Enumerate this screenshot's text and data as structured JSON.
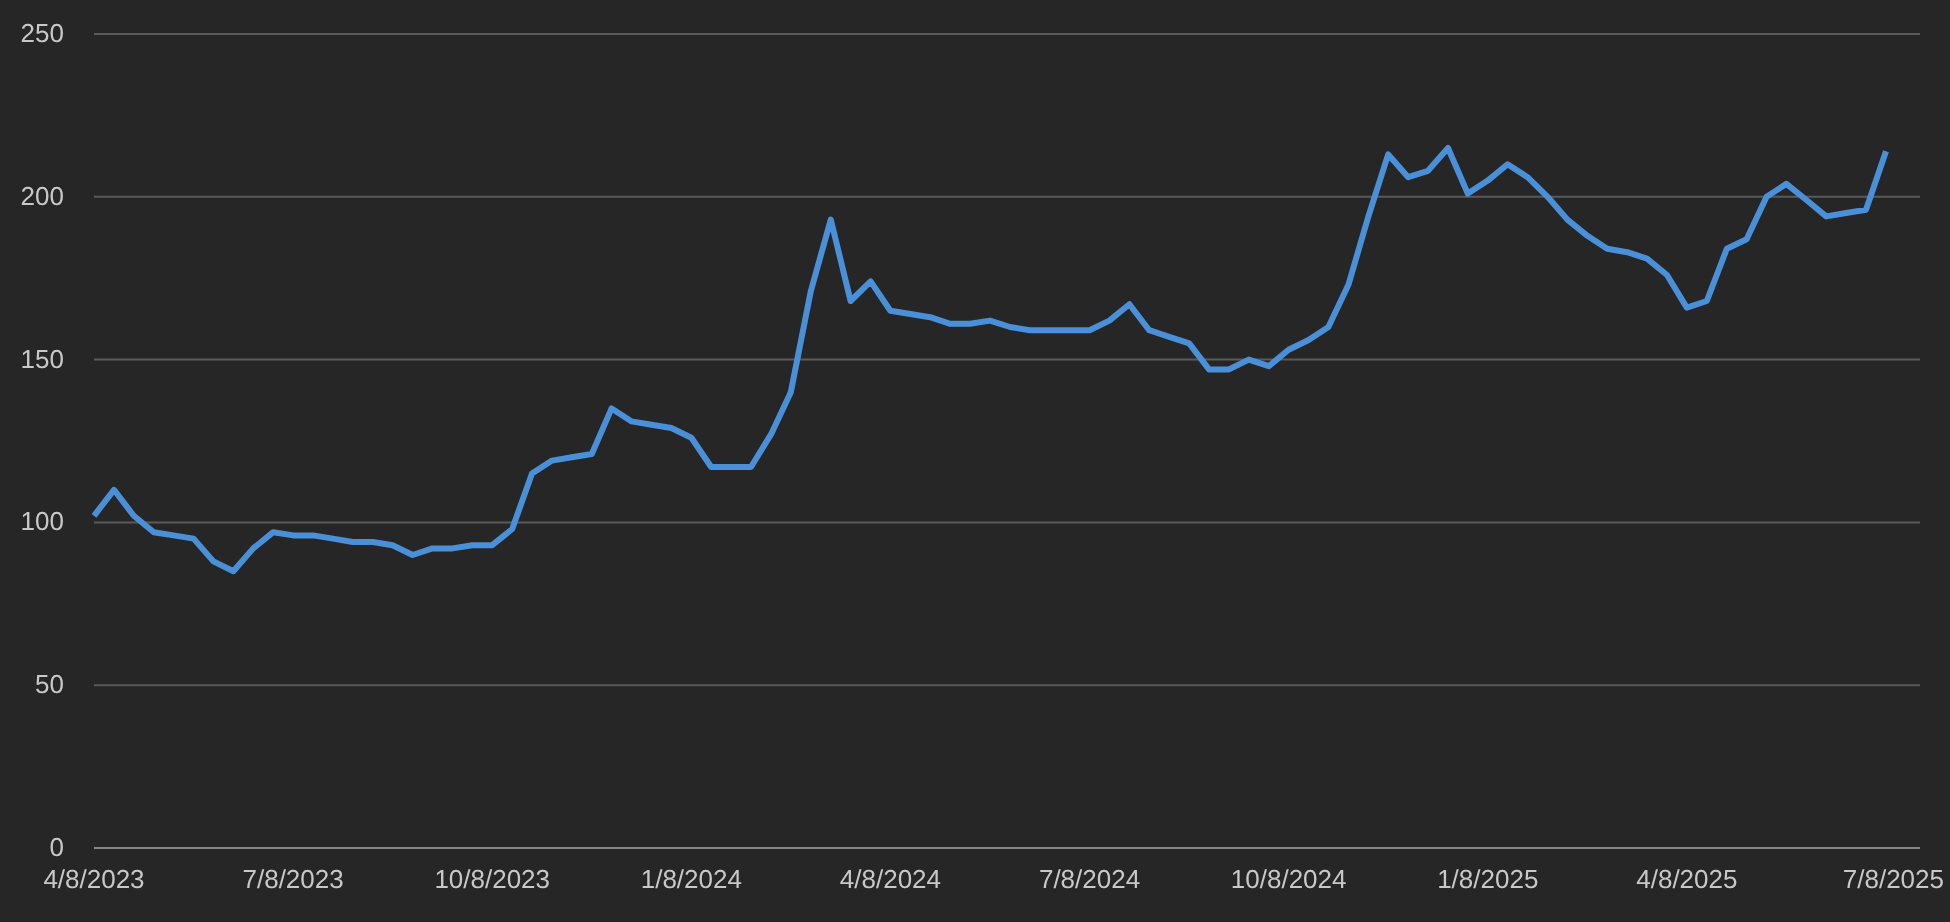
{
  "chart_data": {
    "type": "line",
    "grid": true,
    "ylim": [
      0,
      250
    ],
    "yticks": [
      0,
      50,
      100,
      150,
      200,
      250
    ],
    "categories": [
      "4/8/2023",
      null,
      null,
      null,
      null,
      null,
      null,
      null,
      null,
      null,
      "7/8/2023",
      null,
      null,
      null,
      null,
      null,
      null,
      null,
      null,
      null,
      "10/8/2023",
      null,
      null,
      null,
      null,
      null,
      null,
      null,
      null,
      null,
      "1/8/2024",
      null,
      null,
      null,
      null,
      null,
      null,
      null,
      null,
      null,
      "4/8/2024",
      null,
      null,
      null,
      null,
      null,
      null,
      null,
      null,
      null,
      "7/8/2024",
      null,
      null,
      null,
      null,
      null,
      null,
      null,
      null,
      null,
      "10/8/2024",
      null,
      null,
      null,
      null,
      null,
      null,
      null,
      null,
      null,
      "1/8/2025",
      null,
      null,
      null,
      null,
      null,
      null,
      null,
      null,
      null,
      "4/8/2025",
      null,
      null,
      null,
      null,
      null,
      null,
      null,
      null,
      null,
      "7/8/2025"
    ],
    "series": [
      {
        "color": "#4a90d9",
        "values": [
          102,
          110,
          102,
          97,
          96,
          95,
          88,
          85,
          92,
          97,
          96,
          96,
          95,
          94,
          94,
          93,
          90,
          92,
          92,
          93,
          93,
          98,
          115,
          119,
          120,
          121,
          135,
          131,
          130,
          129,
          126,
          117,
          117,
          117,
          127,
          140,
          171,
          193,
          168,
          174,
          165,
          164,
          163,
          161,
          161,
          162,
          160,
          159,
          159,
          159,
          159,
          162,
          167,
          159,
          157,
          155,
          147,
          147,
          150,
          148,
          153,
          156,
          160,
          173,
          194,
          213,
          206,
          208,
          215,
          201,
          205,
          210,
          206,
          200,
          193,
          188,
          184,
          183,
          181,
          176,
          166,
          168,
          184,
          187,
          200,
          204,
          199,
          194,
          195,
          196,
          214
        ]
      }
    ]
  }
}
